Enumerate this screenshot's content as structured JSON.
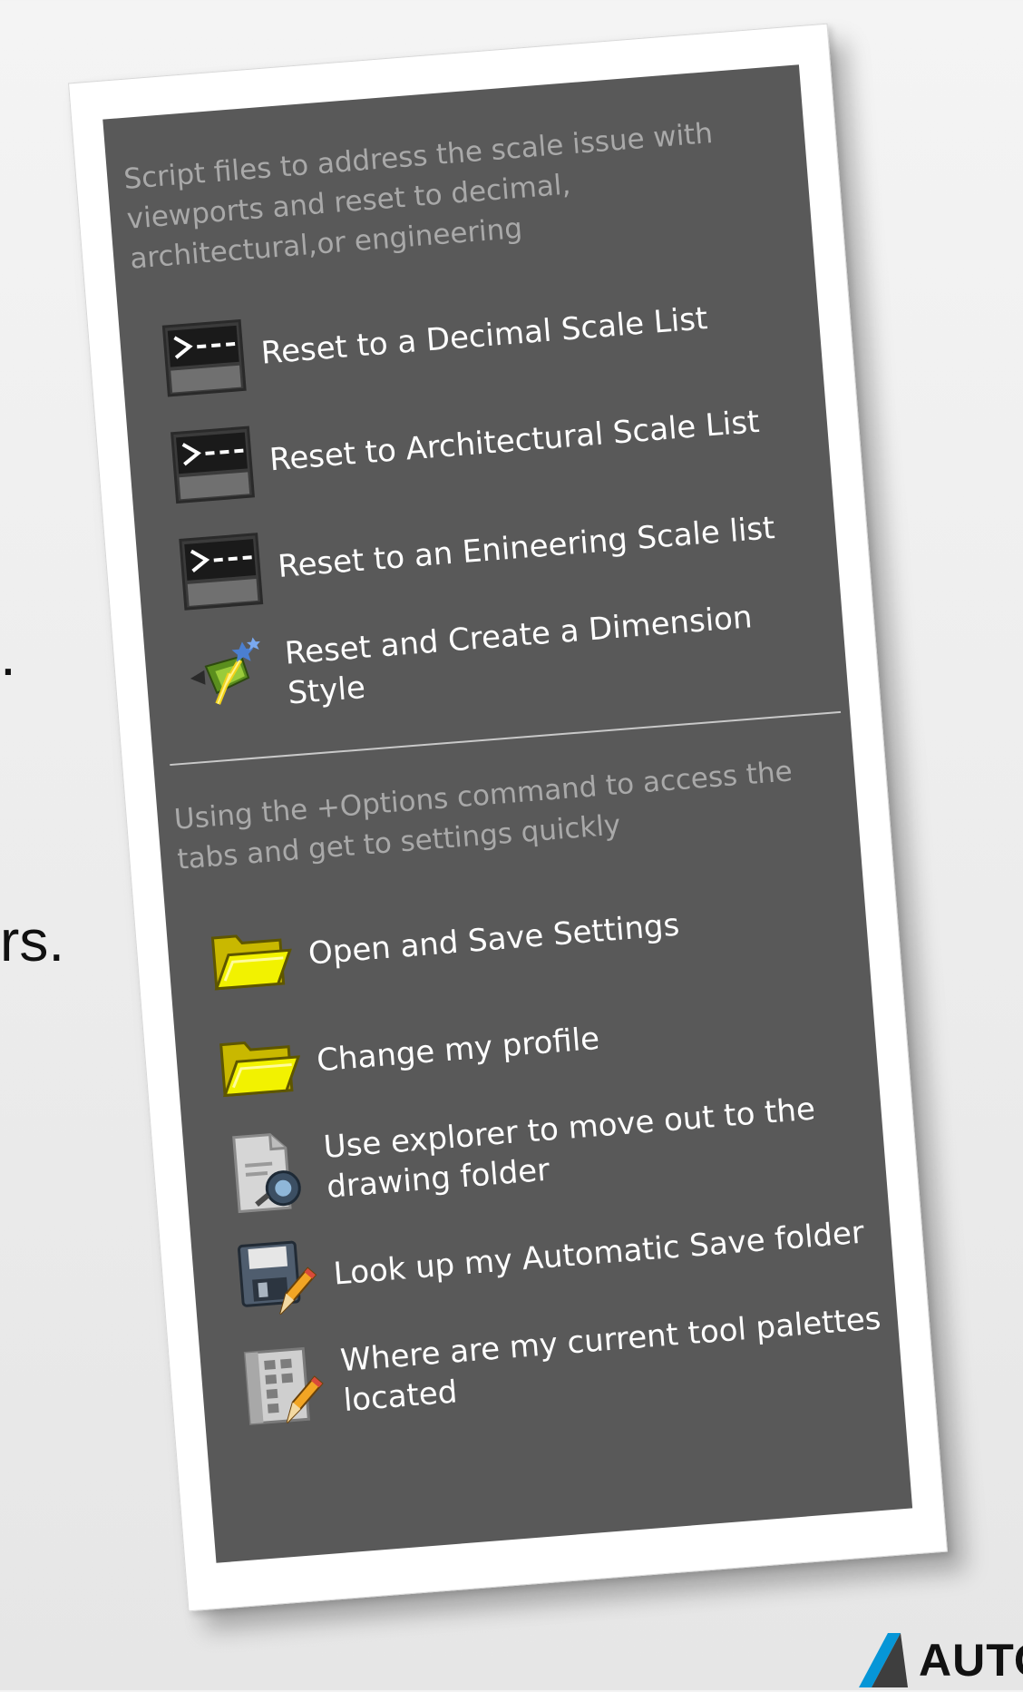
{
  "background": {
    "fragment_1": ".",
    "fragment_2": "rs."
  },
  "brand": {
    "wordmark": "AUTO",
    "logo_icon": "autodesk-logo-icon",
    "logo_color": "#0696d7"
  },
  "palette": {
    "background_color": "#595959",
    "sections": [
      {
        "description": "Script files to address the scale issue with viewports and reset to decimal, architectural,or engineering",
        "items": [
          {
            "label": "Reset to a Decimal Scale List",
            "icon": "script-prompt-icon"
          },
          {
            "label": "Reset to Architectural Scale List",
            "icon": "script-prompt-icon"
          },
          {
            "label": "Reset to an Enineering Scale list",
            "icon": "script-prompt-icon"
          },
          {
            "label": "Reset and Create a Dimension Style",
            "icon": "wizard-lightning-icon"
          }
        ]
      },
      {
        "description": "Using the +Options command to access the tabs and get to settings quickly",
        "items": [
          {
            "label": "Open and Save Settings",
            "icon": "open-folder-icon"
          },
          {
            "label": "Change my profile",
            "icon": "open-folder-icon"
          },
          {
            "label": "Use explorer to move out to the drawing folder",
            "icon": "explorer-document-icon"
          },
          {
            "label": "Look up my Automatic Save folder",
            "icon": "floppy-disk-pencil-icon"
          },
          {
            "label": "Where are my current tool palettes located",
            "icon": "tool-palette-pencil-icon"
          }
        ]
      }
    ]
  }
}
